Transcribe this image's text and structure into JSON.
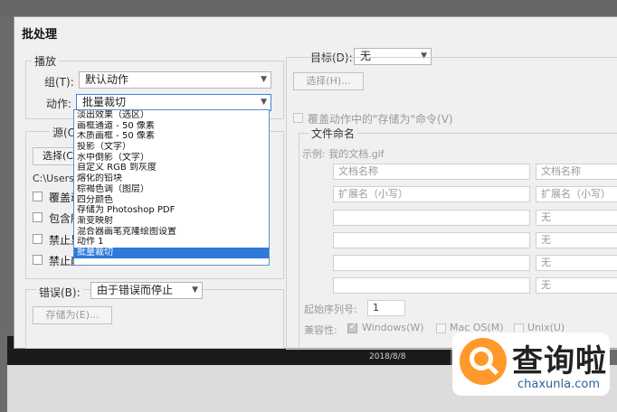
{
  "window": {
    "title": "批处理"
  },
  "playback": {
    "legend": "播放",
    "set_label": "组(T):",
    "set_value": "默认动作",
    "action_label": "动作:",
    "action_value": "批量裁切",
    "action_options": [
      "淡出效果（选区）",
      "画框通道 - 50 像素",
      "木质画框 - 50 像素",
      "投影（文字）",
      "水中倒影（文字）",
      "自定义 RGB 到灰度",
      "熔化的铅块",
      "棕褐色调（图层）",
      "四分颜色",
      "存储为 Photoshop PDF",
      "渐变映射",
      "混合器画笔克隆绘图设置",
      "动作 1",
      "批量裁切"
    ],
    "selected_index": 13
  },
  "source": {
    "legend": "源(O)",
    "choose_button": "选择(C",
    "path": "C:\\Users\\",
    "checkboxes": [
      "覆盖动",
      "包含所",
      "禁止显",
      "禁止颜"
    ]
  },
  "errors": {
    "label": "错误(B):",
    "value": "由于错误而停止",
    "save_as_button": "存储为(E)..."
  },
  "destination": {
    "label": "目标(D):",
    "value": "无",
    "choose_button": "选择(H)...",
    "override_label": "覆盖动作中的\"存储为\"命令(V)",
    "file_naming_legend": "文件命名",
    "example": "示例: 我的文档.gif",
    "naming_rows": [
      {
        "left": "文档名称",
        "right": "文档名称"
      },
      {
        "left": "扩展名（小写）",
        "right": "扩展名（小写）"
      },
      {
        "left": "",
        "right": "无"
      },
      {
        "left": "",
        "right": "无"
      },
      {
        "left": "",
        "right": "无"
      },
      {
        "left": "",
        "right": "无"
      }
    ],
    "serial_label": "起始序列号:",
    "serial_value": "1",
    "compat_label": "兼容性:",
    "compat_options": [
      "Windows(W)",
      "Mac OS(M)",
      "Unix(U)"
    ]
  },
  "background": {
    "date_text": "2018/8/8"
  },
  "watermark": {
    "brand": "查询啦",
    "domain": "chaxunla.com"
  }
}
